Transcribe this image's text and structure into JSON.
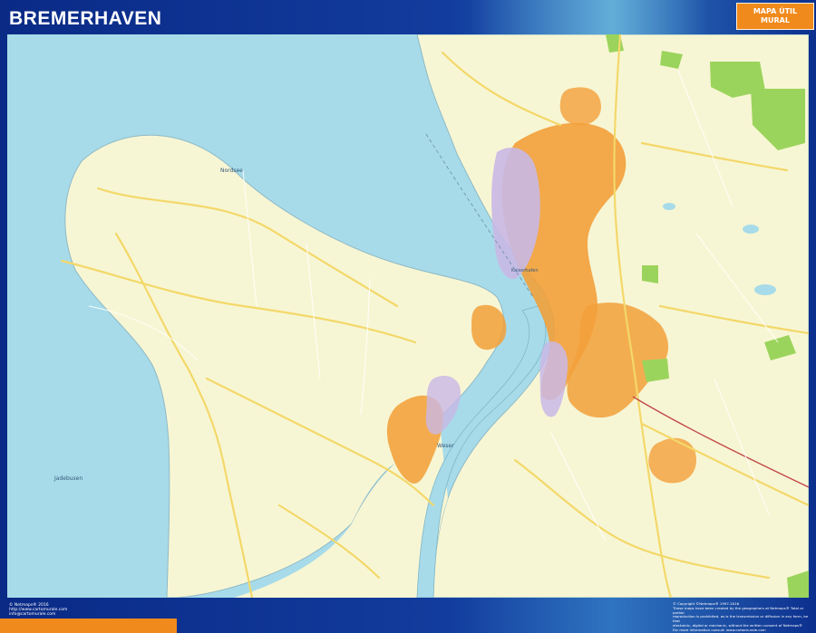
{
  "map": {
    "title": "BREMERHAVEN",
    "badge": {
      "line1": "MAPA ÚTIL",
      "line2": "MURAL"
    },
    "water_labels": {
      "north_coast": "Nordsee",
      "west_bay": "Jadebusen",
      "river": "Weser",
      "harbour": "Kaiserhafen"
    },
    "colors": {
      "frame_blue": "#0d2f8a",
      "water": "#a7dbe9",
      "land": "#f7f6d4",
      "urban": "#f2a03a",
      "industrial": "#c9b8e6",
      "park": "#9bd45c",
      "main_road": "#f3d86a",
      "badge_orange": "#f08a1c"
    }
  },
  "footer": {
    "left": {
      "line1": "© Netmaps® 2016",
      "line2": "http://www.cartomurale.com",
      "line3": "info@cartomurale.com"
    },
    "right": {
      "line1": "© Copyright ©Netmaps® 1997-2016",
      "line2": "These maps have been created by the geographers at Netmaps® Total or partial",
      "line3": "reproduction is prohibited, as is the transmission or diffusion in any form, be that",
      "line4": "electronic, digital or mechanic, without the written consent of Netmaps®",
      "line5": "For more information consult: www.cartomurale.com"
    }
  }
}
